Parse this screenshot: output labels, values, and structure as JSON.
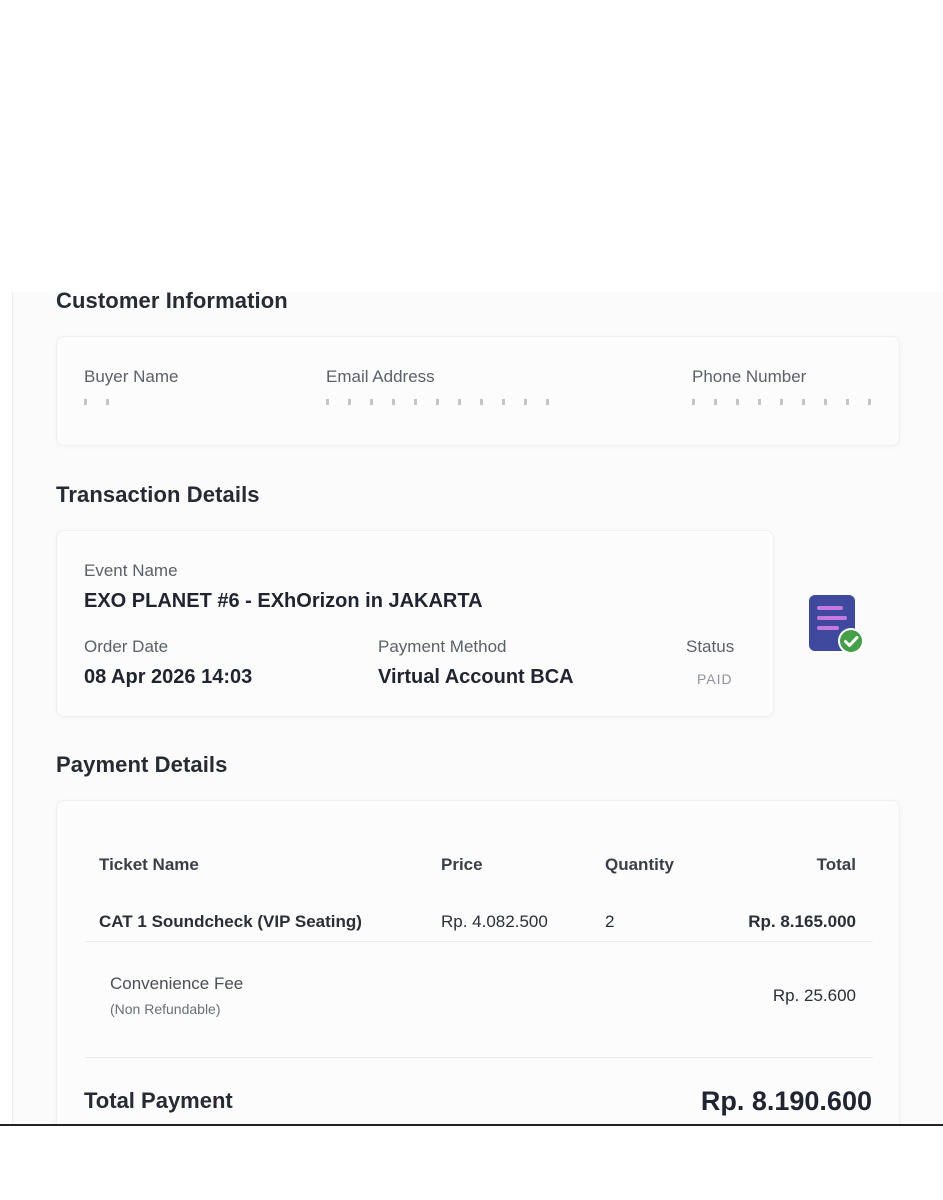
{
  "customer_information": {
    "title": "Customer Information",
    "buyer_name_label": "Buyer Name",
    "email_label": "Email Address",
    "phone_label": "Phone Number"
  },
  "transaction_details": {
    "title": "Transaction Details",
    "event_name_label": "Event Name",
    "event_name": "EXO PLANET #6 - EXhOrizon in JAKARTA",
    "order_date_label": "Order Date",
    "order_date": "08 Apr 2026 14:03",
    "payment_method_label": "Payment Method",
    "payment_method": "Virtual Account BCA",
    "status_label": "Status",
    "status": "PAID",
    "icon": "receipt-check-icon",
    "icon_colors": {
      "doc": "#3f4a9e",
      "lines": "#c879e0",
      "check": "#43a047"
    }
  },
  "payment_details": {
    "title": "Payment Details",
    "columns": [
      "Ticket Name",
      "Price",
      "Quantity",
      "Total"
    ],
    "items": [
      {
        "ticket_name": "CAT 1 Soundcheck (VIP Seating)",
        "price": "Rp. 4.082.500",
        "quantity": "2",
        "total": "Rp. 8.165.000"
      }
    ],
    "convenience_fee_label": "Convenience Fee",
    "convenience_fee_note": "(Non Refundable)",
    "convenience_fee": "Rp. 25.600",
    "total_payment_label": "Total Payment",
    "total_payment": "Rp. 8.190.600"
  }
}
